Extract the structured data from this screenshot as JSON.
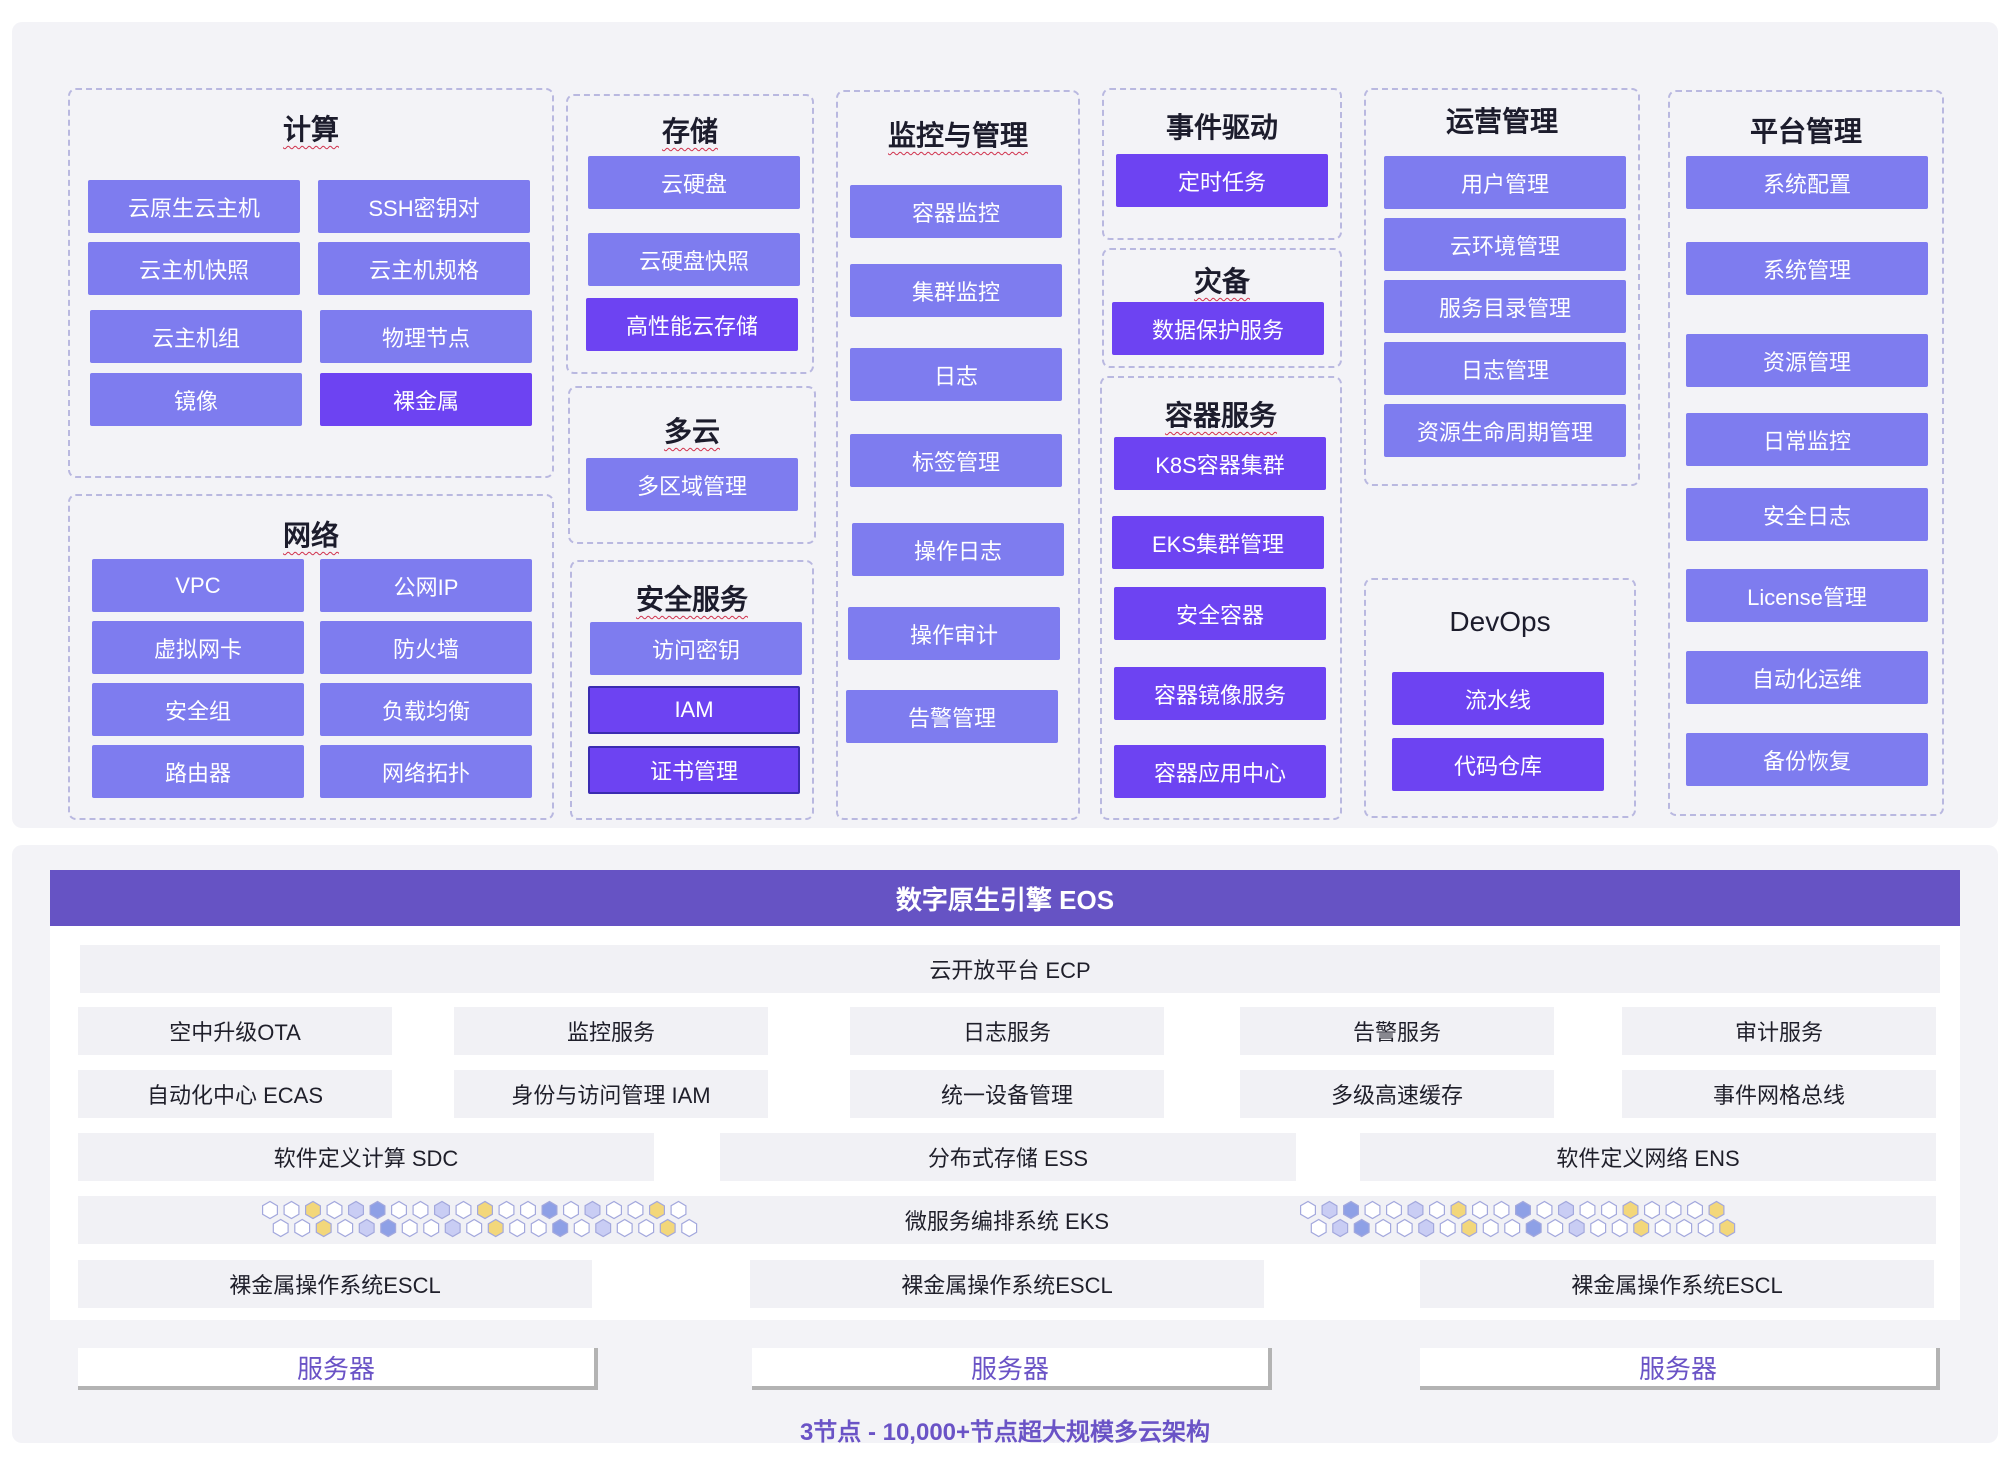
{
  "groups": {
    "compute": {
      "title": "计算",
      "items": [
        "云原生云主机",
        "SSH密钥对",
        "云主机快照",
        "云主机规格",
        "云主机组",
        "物理节点",
        "镜像",
        "裸金属"
      ]
    },
    "network": {
      "title": "网络",
      "items": [
        "VPC",
        "公网IP",
        "虚拟网卡",
        "防火墙",
        "安全组",
        "负载均衡",
        "路由器",
        "网络拓扑"
      ]
    },
    "storage": {
      "title": "存储",
      "items": [
        "云硬盘",
        "云硬盘快照",
        "高性能云存储"
      ]
    },
    "multicloud": {
      "title": "多云",
      "items": [
        "多区域管理"
      ]
    },
    "security": {
      "title": "安全服务",
      "items": [
        "访问密钥",
        "IAM",
        "证书管理"
      ]
    },
    "monitor": {
      "title": "监控与管理",
      "items": [
        "容器监控",
        "集群监控",
        "日志",
        "标签管理",
        "操作日志",
        "操作审计",
        "告警管理"
      ]
    },
    "event": {
      "title": "事件驱动",
      "items": [
        "定时任务"
      ]
    },
    "dr": {
      "title": "灾备",
      "items": [
        "数据保护服务"
      ]
    },
    "container": {
      "title": "容器服务",
      "items": [
        "K8S容器集群",
        "EKS集群管理",
        "安全容器",
        "容器镜像服务",
        "容器应用中心"
      ]
    },
    "ops": {
      "title": "运营管理",
      "items": [
        "用户管理",
        "云环境管理",
        "服务目录管理",
        "日志管理",
        "资源生命周期管理"
      ]
    },
    "devops": {
      "title": "DevOps",
      "items": [
        "流水线",
        "代码仓库"
      ]
    },
    "platform": {
      "title": "平台管理",
      "items": [
        "系统配置",
        "系统管理",
        "资源管理",
        "日常监控",
        "安全日志",
        "License管理",
        "自动化运维",
        "备份恢复"
      ]
    }
  },
  "engine": {
    "title": "数字原生引擎 EOS",
    "ecp": "云开放平台 ECP",
    "row1": [
      "空中升级OTA",
      "监控服务",
      "日志服务",
      "告警服务",
      "审计服务"
    ],
    "row2": [
      "自动化中心 ECAS",
      "身份与访问管理 IAM",
      "统一设备管理",
      "多级高速缓存",
      "事件网格总线"
    ],
    "row3": [
      "软件定义计算 SDC",
      "分布式存储 ESS",
      "软件定义网络 ENS"
    ],
    "eks": "微服务编排系统 EKS",
    "row5": [
      "裸金属操作系统ESCL",
      "裸金属操作系统ESCL",
      "裸金属操作系统ESCL"
    ]
  },
  "servers": [
    "服务器",
    "服务器",
    "服务器"
  ],
  "footer": "3节点 - 10,000+节点超大规模多云架构",
  "colors": {
    "button": "#7e7cef",
    "button_dark": "#6d43f2",
    "band": "#6653c4",
    "accent_text": "#6a53c6"
  }
}
